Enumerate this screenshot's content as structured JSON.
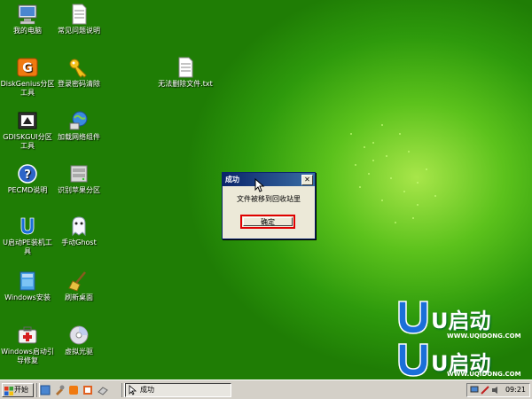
{
  "desktop": {
    "icons": [
      {
        "label": "我的电脑",
        "icon": "computer-icon"
      },
      {
        "label": "常见问题说明",
        "icon": "text-file-icon"
      },
      {
        "label": "DiskGenius分区工具",
        "icon": "diskgenius-icon"
      },
      {
        "label": "登录密码清除",
        "icon": "key-icon"
      },
      {
        "label": "无法删除文件.txt",
        "icon": "text-file-icon"
      },
      {
        "label": "GDISKGUI分区工具",
        "icon": "gdisk-icon"
      },
      {
        "label": "加载网络组件",
        "icon": "network-globe-icon"
      },
      {
        "label": "PECMD说明",
        "icon": "help-icon"
      },
      {
        "label": "识别苹果分区",
        "icon": "disk-drive-icon"
      },
      {
        "label": "U启动PE装机工具",
        "icon": "u-logo-icon"
      },
      {
        "label": "手动Ghost",
        "icon": "ghost-icon"
      },
      {
        "label": "Windows安装",
        "icon": "windows-install-icon"
      },
      {
        "label": "刷新桌面",
        "icon": "broom-icon"
      },
      {
        "label": "Windows启动引导修复",
        "icon": "first-aid-icon"
      },
      {
        "label": "虚拟光驱",
        "icon": "virtual-cd-icon"
      }
    ],
    "logo": {
      "brand": "U启动",
      "url": "WWW.UQIDONG.COM"
    }
  },
  "dialog": {
    "title": "成功",
    "close": "✕",
    "message": "文件被移到回收站里",
    "ok_label": "确定"
  },
  "taskbar": {
    "start_label": "开始",
    "task_label": "成功",
    "clock": "09:21"
  }
}
